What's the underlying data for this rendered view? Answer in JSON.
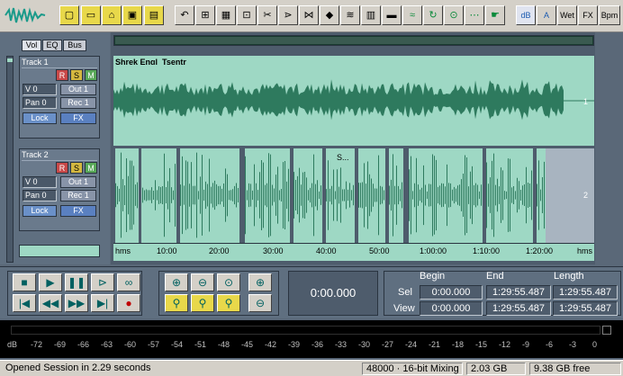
{
  "toolbar": {
    "fx_icon": "wave-logo",
    "wet_label": "Wet",
    "fx_label": "FX",
    "bpm_label": "Bpm",
    "db_label": "dB"
  },
  "panel_tabs": [
    "Vol",
    "EQ",
    "Bus"
  ],
  "tracks": [
    {
      "name": "Track 1",
      "r": "R",
      "s": "S",
      "m": "M",
      "volume": "V 0",
      "out": "Out 1",
      "pan": "Pan 0",
      "rec": "Rec 1",
      "lock": "Lock",
      "fx": "FX",
      "clip_label": "Shrek Engl_Tsentr",
      "lane_number": "1"
    },
    {
      "name": "Track 2",
      "r": "R",
      "s": "S",
      "m": "M",
      "volume": "V 0",
      "out": "Out 1",
      "pan": "Pan 0",
      "rec": "Rec 1",
      "lock": "Lock",
      "fx": "FX",
      "clip_label": "S...",
      "lane_number": "2"
    }
  ],
  "timeline": {
    "start_label": "hms",
    "end_label": "hms",
    "ticks": [
      "10:00",
      "20:00",
      "30:00",
      "40:00",
      "50:00",
      "1:00:00",
      "1:10:00",
      "1:20:00"
    ]
  },
  "transport": {
    "current_time": "0:00.000",
    "headers": {
      "begin": "Begin",
      "end": "End",
      "length": "Length"
    },
    "sel": {
      "label": "Sel",
      "begin": "0:00.000",
      "end": "1:29:55.487",
      "length": "1:29:55.487"
    },
    "view": {
      "label": "View",
      "begin": "0:00.000",
      "end": "1:29:55.487",
      "length": "1:29:55.487"
    }
  },
  "meter": {
    "scale": [
      "dB",
      "-72",
      "-69",
      "-66",
      "-63",
      "-60",
      "-57",
      "-54",
      "-51",
      "-48",
      "-45",
      "-42",
      "-39",
      "-36",
      "-33",
      "-30",
      "-27",
      "-24",
      "-21",
      "-18",
      "-15",
      "-12",
      "-9",
      "-6",
      "-3",
      "0"
    ]
  },
  "status": {
    "message": "Opened Session in 2.29 seconds",
    "format": "48000 · 16-bit Mixing",
    "size": "2.03 GB",
    "free": "9.38 GB free"
  },
  "colors": {
    "wave_fill": "#9ed8c4",
    "wave_ink": "#2e7a5e",
    "accent_yellow": "#e8d84a"
  }
}
